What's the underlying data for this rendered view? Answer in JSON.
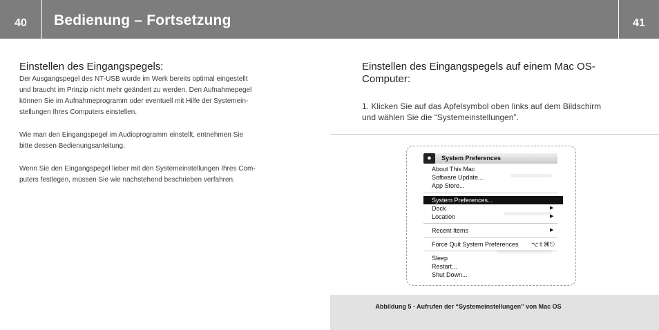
{
  "header": {
    "page_left": "40",
    "page_right": "41",
    "title": "Bedienung – Fortsetzung"
  },
  "left": {
    "heading": "Einstellen des Eingangspegels:",
    "para1_lines": [
      "Der Ausgangspegel des NT-USB wurde im Werk bereits optimal eingestellt",
      "und braucht im Prinzip nicht mehr geändert zu werden. Den Aufnahmepegel",
      "können Sie im Aufnahmeprogramm oder eventuell mit Hilfe der Systemein-",
      "stellungen Ihres Computers einstellen."
    ],
    "para2_lines": [
      "Wie man den Eingangspegel im Audioprogramm einstellt, entnehmen Sie",
      "bitte dessen Bedienungsanleitung."
    ],
    "para3_lines": [
      "Wenn Sie den Eingangspegel lieber mit den Systemeinstellungen Ihres Com-",
      "puters festlegen, müssen Sie wie nachstehend beschrieben verfahren."
    ]
  },
  "right": {
    "heading_lines": [
      "Einstellen des Eingangspegels auf einem Mac OS-",
      "Computer:"
    ],
    "step_lines": [
      "1. Klicken Sie auf das Apfelsymbol oben links auf dem Bildschirm",
      "und wählen Sie die “Systemeinstellungen”."
    ]
  },
  "menu": {
    "apple_icon": "apple-logo",
    "bar_title": "System Preferences",
    "about": "About This Mac",
    "software_update": "Software Update...",
    "app_store": "App Store...",
    "system_preferences": "System Preferences...",
    "dock": "Dock",
    "location": "Location",
    "recent_items": "Recent Items",
    "force_quit": "Force Quit System Preferences",
    "force_quit_shortcut": "⌥⇧⌘⎋",
    "sleep": "Sleep",
    "restart": "Restart...",
    "shut_down": "Shut Down...",
    "submenu_arrow": "▶"
  },
  "caption": "Abbildung 5 - Aufrufen der “Systemeinstellungen” von Mac OS"
}
